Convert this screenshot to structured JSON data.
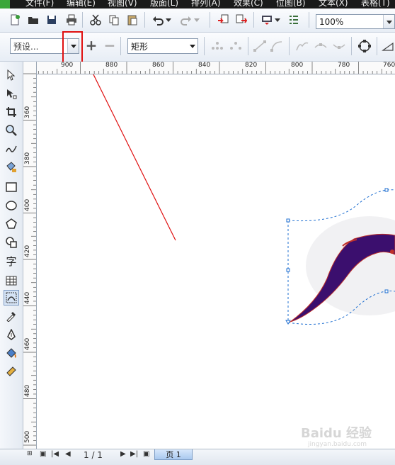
{
  "menu": {
    "items": [
      "文件(F)",
      "编辑(E)",
      "视图(V)",
      "版面(L)",
      "排列(A)",
      "效果(C)",
      "位图(B)",
      "文本(X)",
      "表格(T)"
    ]
  },
  "standard_toolbar": {
    "zoom_value": "100%",
    "icons": [
      "new-icon",
      "open-icon",
      "save-icon",
      "print-icon",
      "cut-icon",
      "copy-icon",
      "paste-icon",
      "undo-icon",
      "redo-icon",
      "import-icon",
      "export-icon",
      "application-launcher-icon",
      "options-icon"
    ]
  },
  "property_bar": {
    "preset_value": "预设...",
    "preset_add_label": "+",
    "preset_remove_label": "−",
    "envelope_mode_value": "矩形"
  },
  "rulers": {
    "horizontal_labels": [
      "900",
      "880",
      "860",
      "840",
      "820",
      "800",
      "780",
      "760"
    ],
    "vertical_labels": [
      "360",
      "380",
      "400",
      "420",
      "440",
      "460",
      "480",
      "500"
    ]
  },
  "toolbox": {
    "tools": [
      "pick-tool-icon",
      "shape-tool-icon",
      "crop-tool-icon",
      "zoom-tool-icon",
      "freehand-tool-icon",
      "smart-fill-tool-icon",
      "rectangle-tool-icon",
      "ellipse-tool-icon",
      "polygon-tool-icon",
      "basic-shapes-tool-icon",
      "text-tool-icon",
      "table-tool-icon",
      "envelope-tool-icon",
      "eyedropper-tool-icon",
      "outline-pen-tool-icon",
      "fill-tool-icon",
      "interactive-fill-tool-icon"
    ],
    "text_tool_glyph": "字",
    "active_tool": "envelope-tool-icon"
  },
  "status": {
    "page_counter": "1 / 1",
    "page_tab": "页 1"
  },
  "watermark": {
    "text": "Baidu 经验",
    "sub": "jingyan.baidu.com"
  },
  "colors": {
    "annotation_red": "#e01010",
    "shape_fill": "#3b0f6e",
    "shape_outline": "#c0302a",
    "envelope_dash": "#1f6fd1"
  }
}
